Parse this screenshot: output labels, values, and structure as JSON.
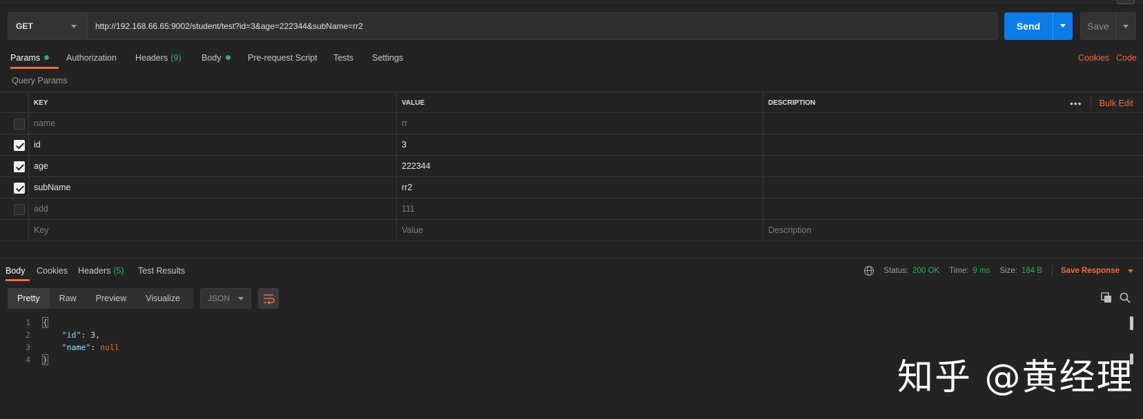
{
  "request": {
    "method": "GET",
    "url": "http://192.168.66.65:9002/student/test?id=3&age=222344&subName=rr2",
    "send_label": "Send",
    "save_label": "Save"
  },
  "request_tabs": {
    "params": "Params",
    "authorization": "Authorization",
    "headers": "Headers",
    "headers_count": "(9)",
    "body": "Body",
    "pre_request": "Pre-request Script",
    "tests": "Tests",
    "settings": "Settings",
    "cookies_link": "Cookies",
    "code_link": "Code"
  },
  "query_params": {
    "title": "Query Params",
    "columns": {
      "key": "KEY",
      "value": "VALUE",
      "description": "DESCRIPTION"
    },
    "bulk_edit": "Bulk Edit",
    "more": "•••",
    "rows": [
      {
        "checked": false,
        "key": "name",
        "value": "rr",
        "description": ""
      },
      {
        "checked": true,
        "key": "id",
        "value": "3",
        "description": ""
      },
      {
        "checked": true,
        "key": "age",
        "value": "222344",
        "description": ""
      },
      {
        "checked": true,
        "key": "subName",
        "value": "rr2",
        "description": ""
      },
      {
        "checked": false,
        "key": "add",
        "value": "111",
        "description": ""
      }
    ],
    "placeholder": {
      "key": "Key",
      "value": "Value",
      "description": "Description"
    }
  },
  "response_tabs": {
    "body": "Body",
    "cookies": "Cookies",
    "headers": "Headers",
    "headers_count": "(5)",
    "test_results": "Test Results"
  },
  "status": {
    "status_label": "Status:",
    "status_value": "200 OK",
    "time_label": "Time:",
    "time_value": "9 ms",
    "size_label": "Size:",
    "size_value": "184 B",
    "save_response": "Save Response"
  },
  "view": {
    "modes": [
      "Pretty",
      "Raw",
      "Preview",
      "Visualize"
    ],
    "active_mode": "Pretty",
    "format": "JSON"
  },
  "code": {
    "line_numbers": [
      "1",
      "2",
      "3",
      "4"
    ],
    "open_brace": "{",
    "id_key": "\"id\"",
    "id_value": "3",
    "name_key": "\"name\"",
    "name_value": "null",
    "close_brace": "}"
  },
  "watermark": "知乎 @黄经理",
  "colors": {
    "accent": "#f26b3a",
    "send": "#0b7ce8",
    "success": "#2fb25c",
    "background": "#232323"
  }
}
